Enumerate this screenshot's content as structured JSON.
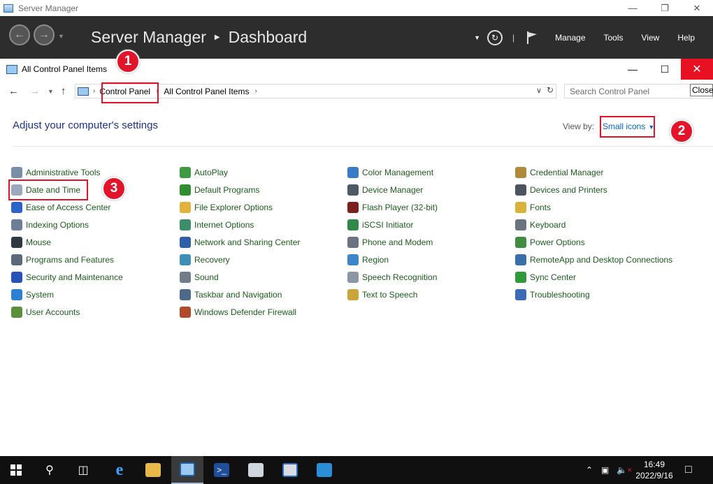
{
  "server_manager": {
    "window_title": "Server Manager",
    "breadcrumb": [
      "Server Manager",
      "Dashboard"
    ],
    "menu": [
      "Manage",
      "Tools",
      "View",
      "Help"
    ]
  },
  "control_panel": {
    "window_title": "All Control Panel Items",
    "address": [
      "Control Panel",
      "All Control Panel Items"
    ],
    "search_placeholder": "Search Control Panel",
    "tooltip": "Close",
    "heading": "Adjust your computer's settings",
    "view_by_label": "View by:",
    "view_by_value": "Small icons",
    "columns": [
      [
        {
          "label": "Administrative Tools",
          "icon": "gear-icon",
          "color": "#7a8ea8"
        },
        {
          "label": "Date and Time",
          "icon": "clock-icon",
          "color": "#9aa9bd"
        },
        {
          "label": "Ease of Access Center",
          "icon": "accessibility-icon",
          "color": "#2b63c6"
        },
        {
          "label": "Indexing Options",
          "icon": "magnifier-icon",
          "color": "#6e7e96"
        },
        {
          "label": "Mouse",
          "icon": "mouse-icon",
          "color": "#303840"
        },
        {
          "label": "Programs and Features",
          "icon": "box-icon",
          "color": "#5b6978"
        },
        {
          "label": "Security and Maintenance",
          "icon": "flag-icon",
          "color": "#2753b8"
        },
        {
          "label": "System",
          "icon": "monitor-icon",
          "color": "#2d7fd0"
        },
        {
          "label": "User Accounts",
          "icon": "users-icon",
          "color": "#5c8f3a"
        }
      ],
      [
        {
          "label": "AutoPlay",
          "icon": "autoplay-icon",
          "color": "#3e9a3e"
        },
        {
          "label": "Default Programs",
          "icon": "check-icon",
          "color": "#2f8f2f"
        },
        {
          "label": "File Explorer Options",
          "icon": "folder-icon",
          "color": "#e1b23c"
        },
        {
          "label": "Internet Options",
          "icon": "globe-icon",
          "color": "#3a8f6a"
        },
        {
          "label": "Network and Sharing Center",
          "icon": "network-icon",
          "color": "#2f5fa8"
        },
        {
          "label": "Recovery",
          "icon": "recovery-icon",
          "color": "#3d8fb8"
        },
        {
          "label": "Sound",
          "icon": "speaker-icon",
          "color": "#707c88"
        },
        {
          "label": "Taskbar and Navigation",
          "icon": "taskbar-icon",
          "color": "#4d6a8c"
        },
        {
          "label": "Windows Defender Firewall",
          "icon": "firewall-icon",
          "color": "#b24b2b"
        }
      ],
      [
        {
          "label": "Color Management",
          "icon": "color-icon",
          "color": "#3a7bc8"
        },
        {
          "label": "Device Manager",
          "icon": "device-manager-icon",
          "color": "#4d5a66"
        },
        {
          "label": "Flash Player (32-bit)",
          "icon": "flash-icon",
          "color": "#7b1f1f"
        },
        {
          "label": "iSCSI Initiator",
          "icon": "iscsi-icon",
          "color": "#2f8a4a"
        },
        {
          "label": "Phone and Modem",
          "icon": "phone-icon",
          "color": "#6a7480"
        },
        {
          "label": "Region",
          "icon": "region-icon",
          "color": "#3a86c8"
        },
        {
          "label": "Speech Recognition",
          "icon": "microphone-icon",
          "color": "#8a96a6"
        },
        {
          "label": "Text to Speech",
          "icon": "speech-icon",
          "color": "#c9a53a"
        }
      ],
      [
        {
          "label": "Credential Manager",
          "icon": "vault-icon",
          "color": "#b08a3a"
        },
        {
          "label": "Devices and Printers",
          "icon": "printer-icon",
          "color": "#4a5560"
        },
        {
          "label": "Fonts",
          "icon": "fonts-icon",
          "color": "#d9b23a"
        },
        {
          "label": "Keyboard",
          "icon": "keyboard-icon",
          "color": "#6a7480"
        },
        {
          "label": "Power Options",
          "icon": "power-icon",
          "color": "#3f8f3f"
        },
        {
          "label": "RemoteApp and Desktop Connections",
          "icon": "remote-icon",
          "color": "#3a6ea8"
        },
        {
          "label": "Sync Center",
          "icon": "sync-icon",
          "color": "#2f9a3a"
        },
        {
          "label": "Troubleshooting",
          "icon": "troubleshoot-icon",
          "color": "#3a6ab8"
        }
      ]
    ]
  },
  "annotations": [
    "1",
    "2",
    "3"
  ],
  "taskbar": {
    "time": "16:49",
    "date": "2022/9/16"
  },
  "colors": {
    "accent_red": "#e3142a",
    "link_green": "#1a5c1a",
    "heading_blue": "#1e3287",
    "sm_header": "#2d2d2d"
  }
}
